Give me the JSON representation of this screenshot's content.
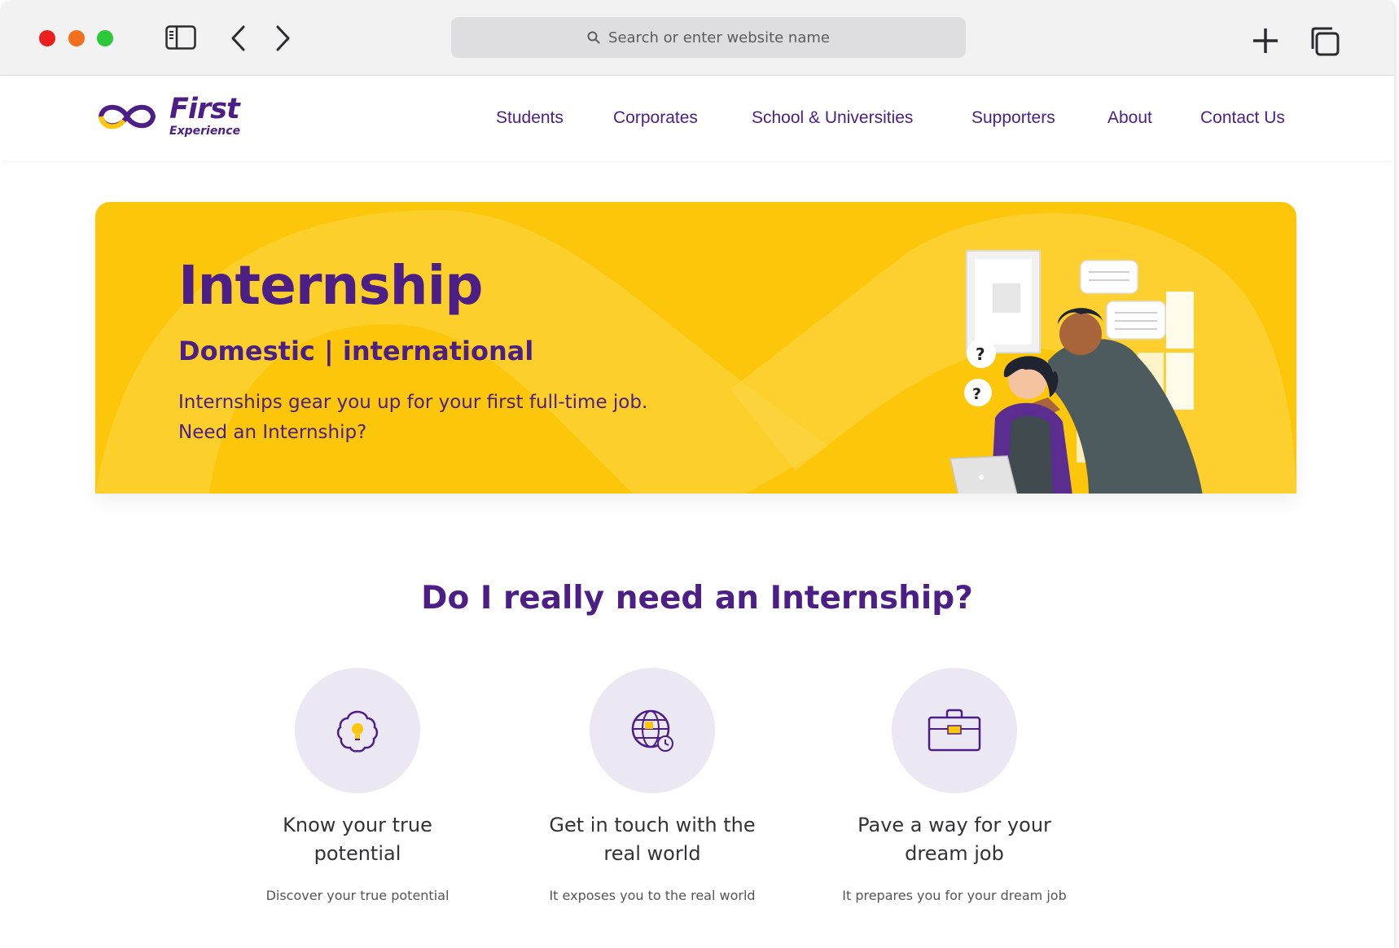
{
  "browser": {
    "url_placeholder": "Search or enter website name"
  },
  "site": {
    "logo": {
      "line1": "First",
      "line2": "Experience"
    },
    "nav": [
      {
        "label": "Students"
      },
      {
        "label": "Corporates"
      },
      {
        "label": "School & Universities"
      },
      {
        "label": "Supporters"
      },
      {
        "label": "About"
      },
      {
        "label": "Contact Us"
      }
    ]
  },
  "hero": {
    "title": "Internship",
    "subtitle": "Domestic | international",
    "line1": "Internships gear you up for your first full-time job.",
    "line2": "Need an Internship?"
  },
  "section": {
    "title": "Do I really need an Internship?",
    "features": [
      {
        "icon": "brain-bulb-icon",
        "title_line1": "Know your true",
        "title_line2": "potential",
        "desc": "Discover your true potential"
      },
      {
        "icon": "globe-clock-icon",
        "title_line1": "Get in touch with the",
        "title_line2": "real world",
        "desc": "It exposes you to the real world"
      },
      {
        "icon": "briefcase-icon",
        "title_line1": "Pave a way for your",
        "title_line2": "dream job",
        "desc": "It prepares you for your dream job"
      }
    ]
  },
  "colors": {
    "brand_purple": "#4b1f86",
    "brand_yellow": "#fcc70b",
    "icon_circle": "#ece8f3"
  }
}
